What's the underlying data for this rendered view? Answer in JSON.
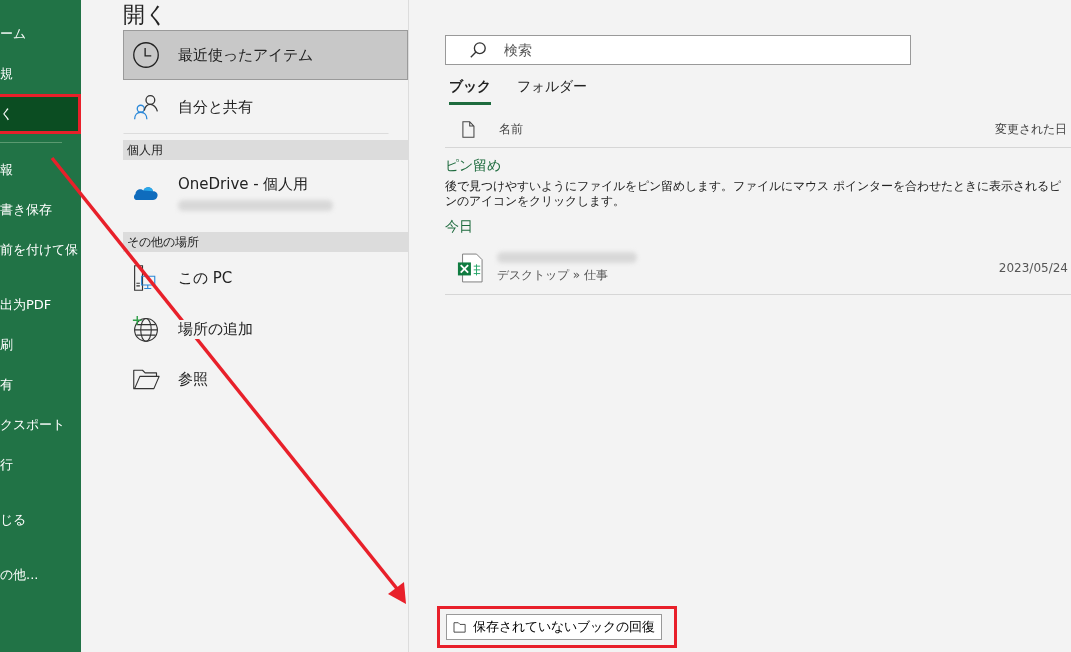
{
  "sidebar": {
    "groups": [
      [
        {
          "label": "ーム",
          "selected": false,
          "highlighted": false
        },
        {
          "label": "規",
          "selected": false,
          "highlighted": false
        },
        {
          "label": "く",
          "selected": true,
          "highlighted": true
        }
      ],
      [
        {
          "label": "報",
          "selected": false,
          "highlighted": false
        },
        {
          "label": "書き保存",
          "selected": false,
          "highlighted": false
        },
        {
          "label": "前を付けて保",
          "selected": false,
          "highlighted": false
        }
      ],
      [
        {
          "label": "出为PDF",
          "selected": false,
          "highlighted": false
        },
        {
          "label": "刷",
          "selected": false,
          "highlighted": false
        },
        {
          "label": "有",
          "selected": false,
          "highlighted": false
        },
        {
          "label": "クスポート",
          "selected": false,
          "highlighted": false
        },
        {
          "label": "行",
          "selected": false,
          "highlighted": false
        }
      ],
      [
        {
          "label": "じる",
          "selected": false,
          "highlighted": false
        }
      ],
      [
        {
          "label": "の他...",
          "selected": false,
          "highlighted": false
        }
      ]
    ]
  },
  "page_title": "開く",
  "places": [
    {
      "kind": "recent",
      "label": "最近使ったアイテム",
      "selected": true
    },
    {
      "kind": "shared",
      "label": "自分と共有",
      "selected": false
    },
    {
      "kind": "header",
      "label": "個人用"
    },
    {
      "kind": "onedrive",
      "label": "OneDrive - 個人用",
      "selected": false
    },
    {
      "kind": "header",
      "label": "その他の場所"
    },
    {
      "kind": "pc",
      "label": "この PC",
      "selected": false
    },
    {
      "kind": "add",
      "label": "場所の追加",
      "selected": false
    },
    {
      "kind": "browse",
      "label": "参照",
      "selected": false
    }
  ],
  "search": {
    "placeholder": "検索"
  },
  "tabs": [
    {
      "label": "ブック",
      "selected": true
    },
    {
      "label": "フォルダー",
      "selected": false
    }
  ],
  "table": {
    "columns": [
      "名前",
      "変更された日"
    ]
  },
  "sections": [
    {
      "title": "ピン留め",
      "note": "後で見つけやすいようにファイルをピン留めします。ファイルにマウス ポインターを合わせたときに表示されるピンのアイコンをクリックします。"
    },
    {
      "title": "今日",
      "files": [
        {
          "path": "デスクトップ » 仕事",
          "date": "2023/05/24"
        }
      ]
    }
  ],
  "recover_button": {
    "label": "保存されていないブックの回復",
    "highlighted": true
  }
}
